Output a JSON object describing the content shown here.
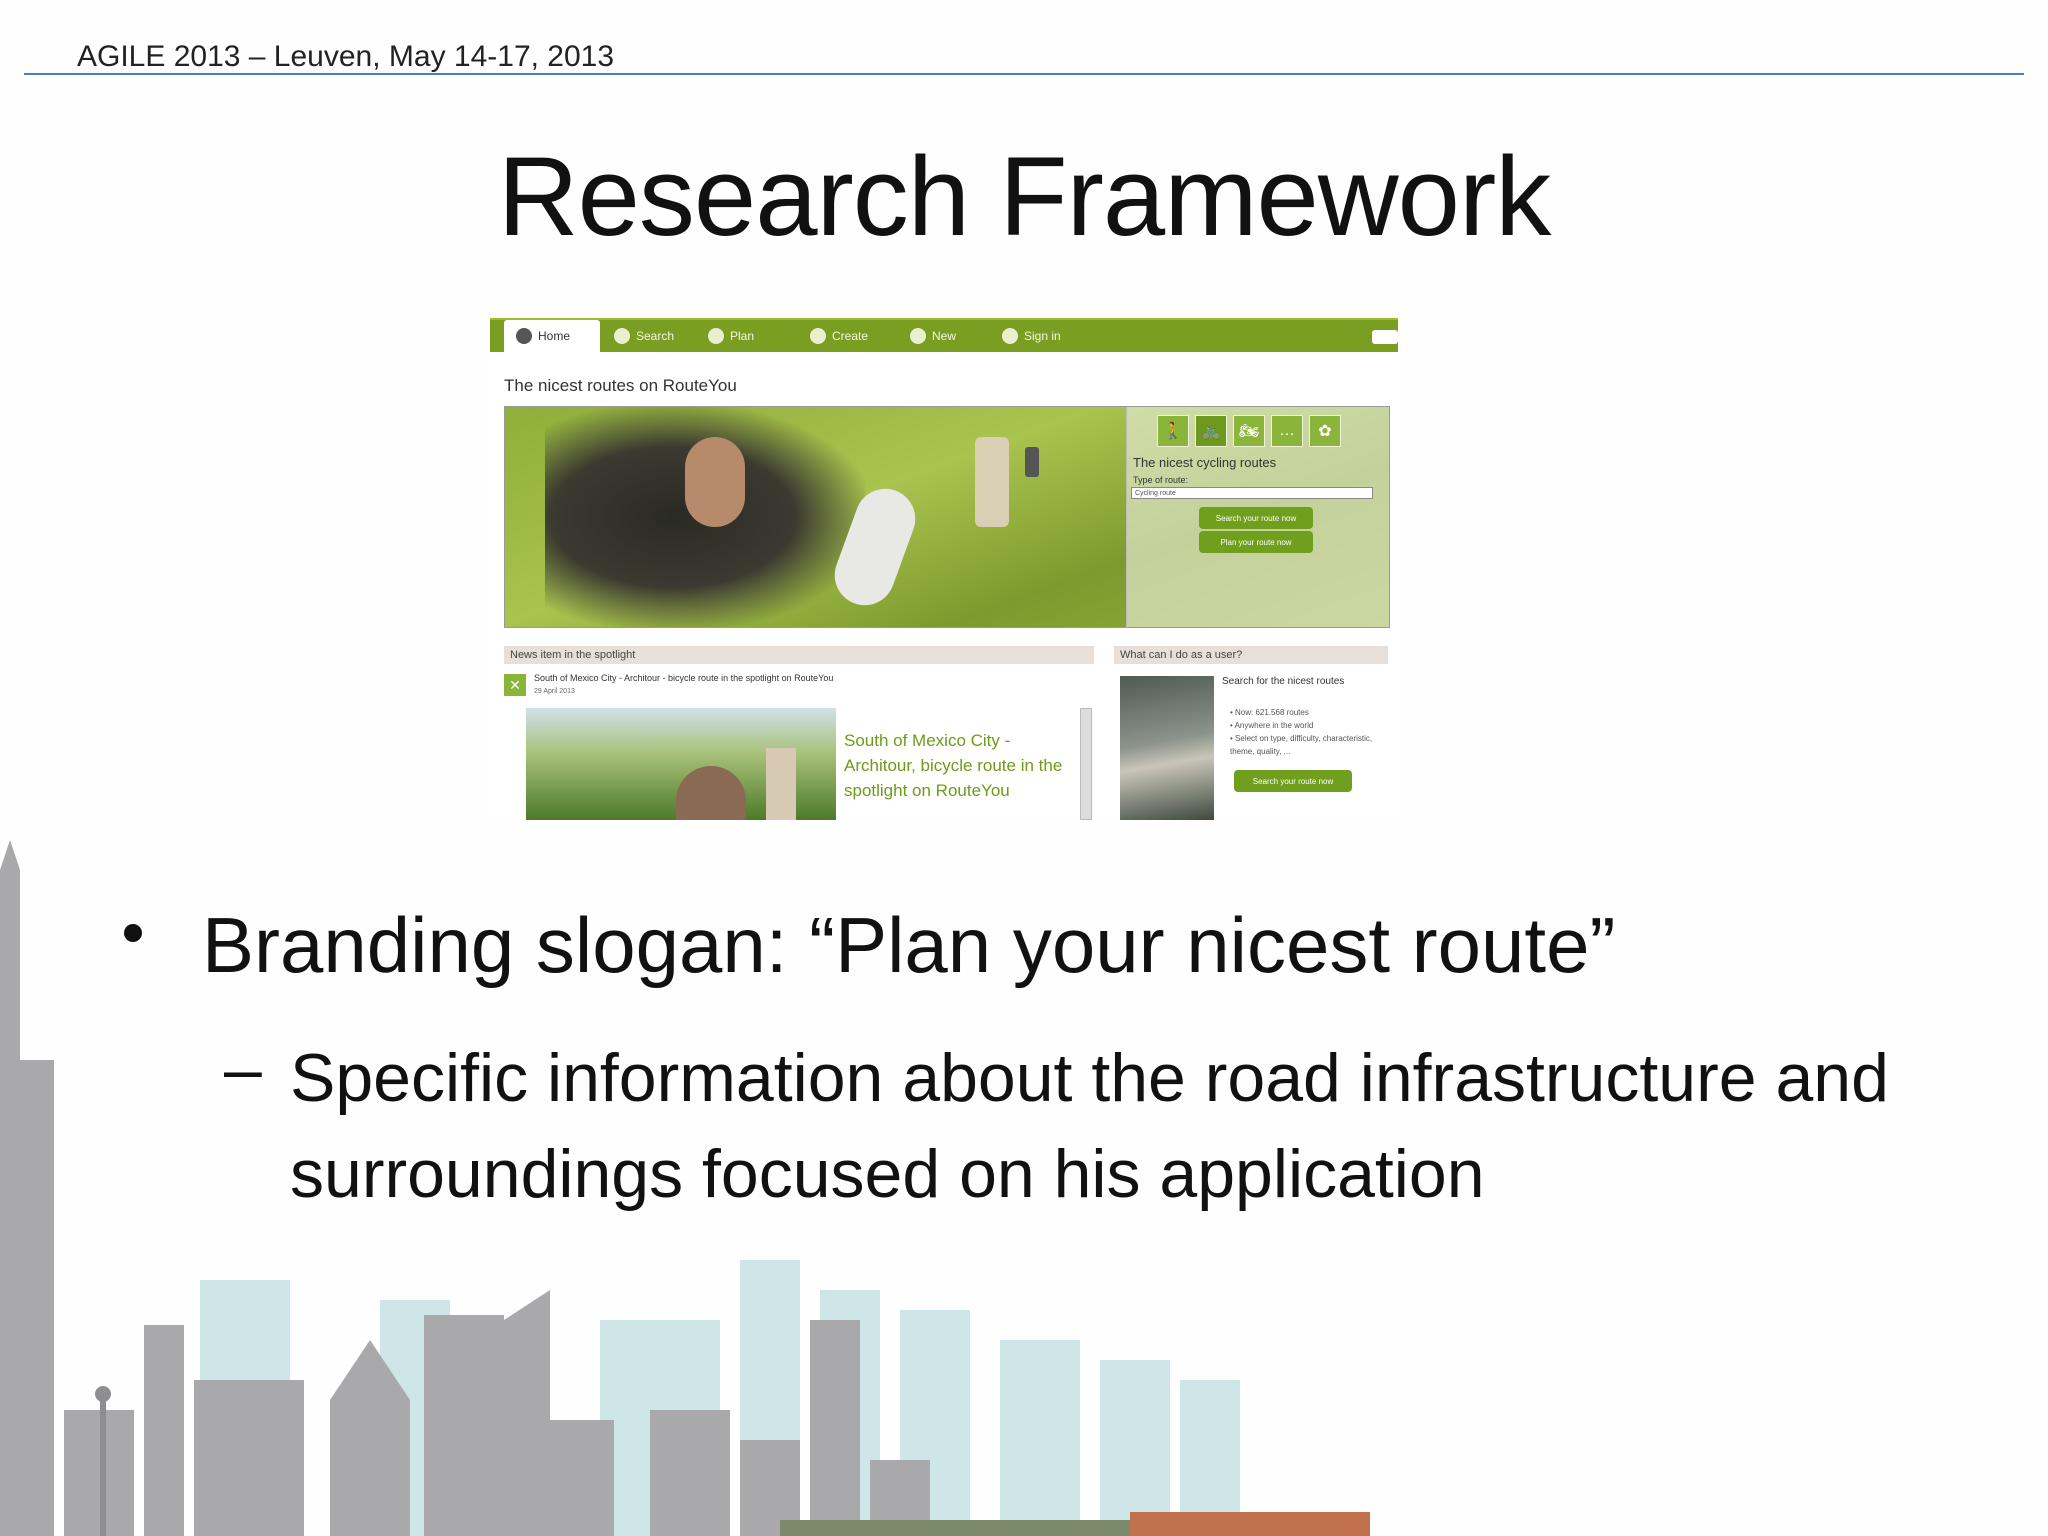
{
  "header": {
    "text": "AGILE 2013 – Leuven, May 14-17, 2013"
  },
  "slide": {
    "title": "Research Framework",
    "bullet_main": "Branding slogan: “Plan your nicest route”",
    "sub_dash": "–",
    "sub_text": "Specific information about the road infrastructure and surroundings focused on his application"
  },
  "website": {
    "nav": [
      {
        "label": "Home",
        "icon": "home-icon"
      },
      {
        "label": "Search",
        "icon": "search-icon"
      },
      {
        "label": "Plan",
        "icon": "globe-icon"
      },
      {
        "label": "Create",
        "icon": "pencil-icon"
      },
      {
        "label": "New",
        "icon": "new-icon"
      },
      {
        "label": "Sign in",
        "icon": "user-icon"
      }
    ],
    "heading": "The nicest routes on RouteYou",
    "panel": {
      "title": "The nicest cycling routes",
      "type_label": "Type of route:",
      "type_value": "Cycling route",
      "search_button": "Search your route now",
      "plan_button": "Plan your route now",
      "mode_icons": [
        "walking-icon",
        "cycling-icon",
        "motorcycle-icon",
        "more-icon",
        "leaf-icon"
      ]
    },
    "news": {
      "bar": "News item in the spotlight",
      "title": "South of Mexico City - Architour - bicycle route in the spotlight on RouteYou",
      "date": "29 April 2013",
      "headline": "South of Mexico City - Architour, bicycle route in the spotlight on RouteYou"
    },
    "user": {
      "bar": "What can I do as a user?",
      "title": "Search for the nicest routes",
      "items": [
        "Now: 621.568 routes",
        "Anywhere in the world",
        "Select on type, difficulty, characteristic, theme, quality, ..."
      ],
      "button": "Search your route now"
    }
  }
}
